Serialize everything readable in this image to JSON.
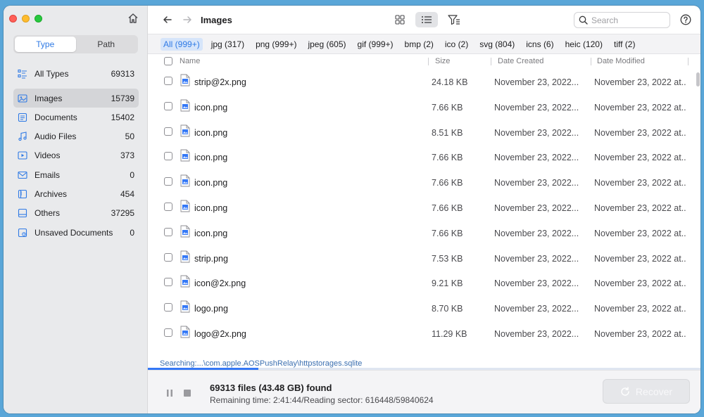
{
  "sidebar": {
    "segment": {
      "type_label": "Type",
      "path_label": "Path"
    },
    "categories": [
      {
        "label": "All Types",
        "count": "69313",
        "icon": "list-icon"
      },
      {
        "label": "Images",
        "count": "15739",
        "icon": "image-icon"
      },
      {
        "label": "Documents",
        "count": "15402",
        "icon": "document-icon"
      },
      {
        "label": "Audio Files",
        "count": "50",
        "icon": "music-icon"
      },
      {
        "label": "Videos",
        "count": "373",
        "icon": "video-icon"
      },
      {
        "label": "Emails",
        "count": "0",
        "icon": "envelope-icon"
      },
      {
        "label": "Archives",
        "count": "454",
        "icon": "archive-icon"
      },
      {
        "label": "Others",
        "count": "37295",
        "icon": "others-icon"
      },
      {
        "label": "Unsaved Documents",
        "count": "0",
        "icon": "unsaved-document-icon"
      }
    ]
  },
  "toolbar": {
    "title": "Images",
    "search_placeholder": "Search"
  },
  "extensions": [
    "All (999+)",
    "jpg (317)",
    "png (999+)",
    "jpeg (605)",
    "gif (999+)",
    "bmp (2)",
    "ico (2)",
    "svg (804)",
    "icns (6)",
    "heic (120)",
    "tiff (2)"
  ],
  "table": {
    "headers": {
      "name": "Name",
      "size": "Size",
      "created": "Date Created",
      "modified": "Date Modified"
    },
    "rows": [
      {
        "name": "strip@2x.png",
        "size": "24.18 KB",
        "created": "November 23, 2022...",
        "modified": "November 23, 2022 at..."
      },
      {
        "name": "icon.png",
        "size": "7.66 KB",
        "created": "November 23, 2022...",
        "modified": "November 23, 2022 at..."
      },
      {
        "name": "icon.png",
        "size": "8.51 KB",
        "created": "November 23, 2022...",
        "modified": "November 23, 2022 at..."
      },
      {
        "name": "icon.png",
        "size": "7.66 KB",
        "created": "November 23, 2022...",
        "modified": "November 23, 2022 at..."
      },
      {
        "name": "icon.png",
        "size": "7.66 KB",
        "created": "November 23, 2022...",
        "modified": "November 23, 2022 at..."
      },
      {
        "name": "icon.png",
        "size": "7.66 KB",
        "created": "November 23, 2022...",
        "modified": "November 23, 2022 at..."
      },
      {
        "name": "icon.png",
        "size": "7.66 KB",
        "created": "November 23, 2022...",
        "modified": "November 23, 2022 at..."
      },
      {
        "name": "strip.png",
        "size": "7.53 KB",
        "created": "November 23, 2022...",
        "modified": "November 23, 2022 at..."
      },
      {
        "name": "icon@2x.png",
        "size": "9.21 KB",
        "created": "November 23, 2022...",
        "modified": "November 23, 2022 at..."
      },
      {
        "name": "logo.png",
        "size": "8.70 KB",
        "created": "November 23, 2022...",
        "modified": "November 23, 2022 at..."
      },
      {
        "name": "logo@2x.png",
        "size": "11.29 KB",
        "created": "November 23, 2022...",
        "modified": "November 23, 2022 at..."
      }
    ]
  },
  "status": {
    "searching_path": "Searching:...\\com.apple.AOSPushRelay\\httpstorages.sqlite",
    "progress_fraction": 0.2,
    "found": "69313 files (43.48 GB) found",
    "remaining": "Remaining time: 2:41:44/Reading sector: 616448/59840624",
    "recover_label": "Recover"
  },
  "colors": {
    "accent": "#2f7ae5",
    "sidebar_bg": "#e9eaec",
    "desktop_bg": "#5aa6d8"
  }
}
